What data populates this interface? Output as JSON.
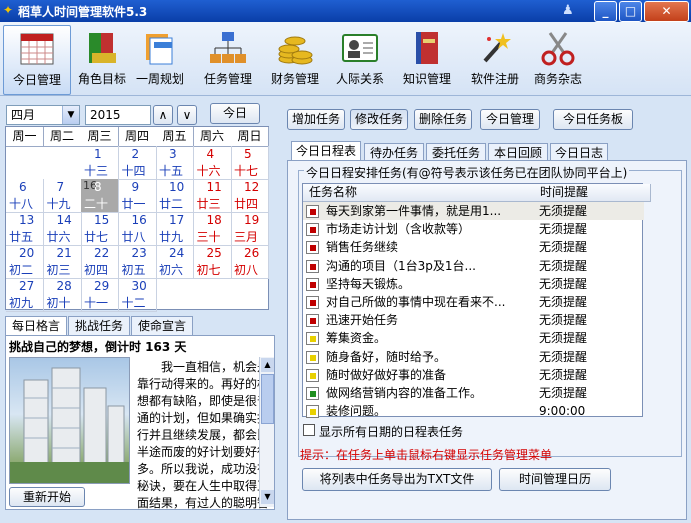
{
  "window": {
    "title": "稻草人时间管理软件5.3"
  },
  "toolbar": {
    "items": [
      {
        "label": "今日管理",
        "icon": "calendar-icon"
      },
      {
        "label": "角色目标",
        "icon": "books-icon"
      },
      {
        "label": "一周规划",
        "icon": "folders-icon"
      },
      {
        "label": "任务管理",
        "icon": "org-chart-icon"
      },
      {
        "label": "财务管理",
        "icon": "coins-icon"
      },
      {
        "label": "人际关系",
        "icon": "contact-card-icon"
      },
      {
        "label": "知识管理",
        "icon": "book-icon"
      },
      {
        "label": "软件注册",
        "icon": "magic-wand-icon"
      },
      {
        "label": "商务杂志",
        "icon": "scissors-icon"
      }
    ]
  },
  "calendar_controls": {
    "month": "四月",
    "year": "2015",
    "today_button": "今日",
    "up": "∧",
    "down": "∨"
  },
  "calendar": {
    "weekdays": [
      "周一",
      "周二",
      "周三",
      "周四",
      "周五",
      "周六",
      "周日"
    ],
    "days": [
      {
        "d": "1",
        "l": "十三"
      },
      {
        "d": "2",
        "l": "十四"
      },
      {
        "d": "3",
        "l": "十五"
      },
      {
        "d": "4",
        "l": "十六"
      },
      {
        "d": "5",
        "l": "十七"
      },
      {
        "d": "6",
        "l": "十八"
      },
      {
        "d": "7",
        "l": "十九"
      },
      {
        "d": "8",
        "l": "二十"
      },
      {
        "d": "9",
        "l": "廿一"
      },
      {
        "d": "10",
        "l": "廿二"
      },
      {
        "d": "11",
        "l": "廿三"
      },
      {
        "d": "12",
        "l": "廿四"
      },
      {
        "d": "13",
        "l": "廿五"
      },
      {
        "d": "14",
        "l": "廿六"
      },
      {
        "d": "15",
        "l": "廿七"
      },
      {
        "d": "16",
        "l": "廿八"
      },
      {
        "d": "17",
        "l": "廿九"
      },
      {
        "d": "18",
        "l": "三十"
      },
      {
        "d": "19",
        "l": "三月"
      },
      {
        "d": "20",
        "l": "初二"
      },
      {
        "d": "21",
        "l": "初三"
      },
      {
        "d": "22",
        "l": "初四"
      },
      {
        "d": "23",
        "l": "初五"
      },
      {
        "d": "24",
        "l": "初六"
      },
      {
        "d": "25",
        "l": "初七"
      },
      {
        "d": "26",
        "l": "初八"
      },
      {
        "d": "27",
        "l": "初九"
      },
      {
        "d": "28",
        "l": "初十"
      },
      {
        "d": "29",
        "l": "十一"
      },
      {
        "d": "30",
        "l": "十二"
      }
    ],
    "prev_month_marker": "16"
  },
  "left_tabs": [
    "每日格言",
    "挑战任务",
    "使命宣言"
  ],
  "quote": {
    "title": "挑战自己的梦想，倒计时 163 天",
    "lines": [
      "我一直相信，机会是",
      "靠行动得来的。再好的构",
      "想都有缺陷，即使是很普",
      "通的计划，但如果确实执",
      "行并且继续发展，都会比",
      "半途而废的好计划要好得",
      "多。所以我说，成功没有",
      "秘诀，要在人生中取得正",
      "面结果，有过人的聪明智"
    ],
    "restart_button": "重新开始"
  },
  "top_buttons": [
    "增加任务",
    "修改任务",
    "删除任务",
    "今日管理",
    "今日任务板"
  ],
  "right_tabs": [
    "今日日程表",
    "待办任务",
    "委托任务",
    "本日回顾",
    "今日日志"
  ],
  "schedule": {
    "group_title": "今日日程安排任务(有@符号表示该任务已在团队协同平台上)",
    "col_name": "任务名称",
    "col_remind": "时间提醒",
    "rows": [
      {
        "name": "每天到家第一件事情，就是用1...",
        "remind": "无须提醒",
        "flag": "#c00000"
      },
      {
        "name": "市场走访计划（含收款等）",
        "remind": "无须提醒",
        "flag": "#c00000"
      },
      {
        "name": "销售任务继续",
        "remind": "无须提醒",
        "flag": "#c00000"
      },
      {
        "name": "沟通的项目（1台3p及1台...",
        "remind": "无须提醒",
        "flag": "#c00000"
      },
      {
        "name": "坚持每天锻炼。",
        "remind": "无须提醒",
        "flag": "#c00000"
      },
      {
        "name": "对自己所做的事情中现在看来不...",
        "remind": "无须提醒",
        "flag": "#c00000"
      },
      {
        "name": "迅速开始任务",
        "remind": "无须提醒",
        "flag": "#c00000"
      },
      {
        "name": "筹集资金。",
        "remind": "无须提醒",
        "flag": "#e8d000"
      },
      {
        "name": "随身备好，随时给予。",
        "remind": "无须提醒",
        "flag": "#e8d000"
      },
      {
        "name": "随时做好做好事的准备",
        "remind": "无须提醒",
        "flag": "#e8d000"
      },
      {
        "name": "做网络营销内容的准备工作。",
        "remind": "无须提醒",
        "flag": "#1f8f1f"
      },
      {
        "name": "装修问题。",
        "remind": "9:00:00",
        "flag": "#e8d000"
      }
    ]
  },
  "show_all_checkbox": "显示所有日期的日程表任务",
  "hint": "提示：在任务上单击鼠标右键显示任务管理菜单",
  "bottom_buttons": {
    "export": "将列表中任务导出为TXT文件",
    "time": "时间管理日历"
  },
  "colors": {
    "hint": "#d40000",
    "accent": "#0a3ea8"
  }
}
